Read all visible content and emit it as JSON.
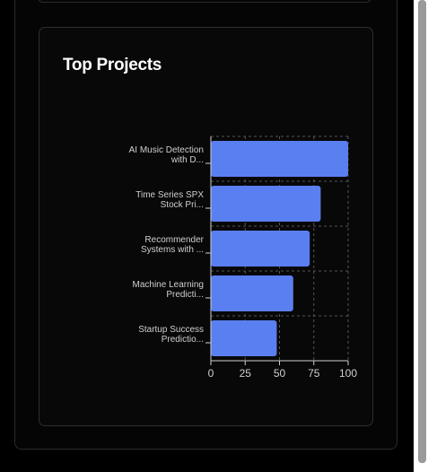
{
  "card": {
    "title": "Top Projects"
  },
  "chart_data": {
    "type": "bar",
    "orientation": "horizontal",
    "categories": [
      "AI Music Detection with D...",
      "Time Series SPX Stock Pri...",
      "Recommender Systems with ...",
      "Machine Learning Predicti...",
      "Startup Success Predictio..."
    ],
    "category_lines": [
      [
        "AI Music Detection",
        "with D..."
      ],
      [
        "Time Series SPX",
        "Stock Pri..."
      ],
      [
        "Recommender",
        "Systems with ..."
      ],
      [
        "Machine Learning",
        "Predicti..."
      ],
      [
        "Startup Success",
        "Predictio..."
      ]
    ],
    "values": [
      100,
      80,
      72,
      60,
      48
    ],
    "xlim": [
      0,
      100
    ],
    "xticks": [
      "0",
      "25",
      "50",
      "75",
      "100"
    ],
    "grid": true,
    "grid_style": "dashed",
    "bar_color": "#5a7ff0",
    "text_color": "#cfcfcf",
    "grid_color": "#555555"
  }
}
